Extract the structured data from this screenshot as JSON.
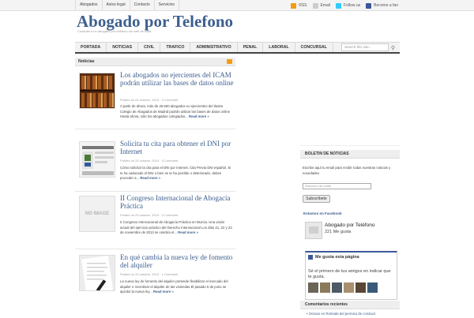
{
  "topnav": [
    "Abogados",
    "Aviso legal",
    "Contacto",
    "Servicios"
  ],
  "social": {
    "rss": "RSS",
    "email": "Email",
    "follow": "Follow us",
    "fan": "Become a fan"
  },
  "site": {
    "title": "Abogado por Telefono",
    "description": "Consulte a un abogado por teléfono sin salir de casa"
  },
  "nav": [
    "PORTADA",
    "NOTICIAS",
    "CIVIL",
    "TRAFICO",
    "ADMINISTRATIVO",
    "PENAL",
    "LABORAL",
    "CONCURSAL"
  ],
  "search": {
    "placeholder": "Search this site..."
  },
  "content": {
    "section": "Noticias",
    "posts": [
      {
        "title": "Los abogados no ejercientes del ICAM podrán utilizar las bases de datos online",
        "meta": "Posted on 24 octubre, 2013 · 0 Comment",
        "excerpt": "A partir de ahora, más de 26.500 abogados no ejercientes del Ilustre Colegio de Abogados de Madrid podrán utilizar las bases de datos online Hasta ahora, sólo los abogados colegiados...",
        "more": "Read more »"
      },
      {
        "title": "Solicita tu cita para obtener el DNI por Internet",
        "meta": "Posted on 24 octubre, 2013 · 0 Comment",
        "excerpt": "Cómo solicitar la cita para el DNI por Internet. Cita Previa DNI español. Si te ha caducado el DNI o bien se te ha perdido o deteriorado, debes proceder a...",
        "more": "Read more »"
      },
      {
        "title": "II Congreso Internacional de Abogacía Práctica",
        "meta": "Posted on 23 octubre, 2013 · 0 Comment",
        "excerpt": "II Congreso Internacional de Abogacía Práctica en Murcia. Una visión actual del ejercicio práctico del Derecho Internacional Los días 21, 22 y 23 de noviembre de 2013 se celebra el...",
        "more": "Read more »",
        "thumb": "NO IMAGE"
      },
      {
        "title": "En qué cambia la nueva ley de fomento del alquiler",
        "meta": "Posted on 23 octubre, 2013 · 1 Comment",
        "excerpt": "La nueva ley de fomento del alquiler pretende flexibilizar el mercado del alquiler e incentivar el alquiler de las viviendas El pasado 6 de junio se aprobó la nueva ley...",
        "more": "Read more »"
      }
    ]
  },
  "sidebar": {
    "newsletter_title": "BOLETIN DE NOTICIAS",
    "newsletter_text": "Escribe aquí tu email para recibir todas nuestras noticias y novedades",
    "email_placeholder": "Dirección de email",
    "subscribe": "Subscribete",
    "fb_heading": "Estamos en Facebook",
    "fb_page": "Abogado por Teléfono",
    "fb_likes": "221 Me gusta",
    "fb_widget_title": "Me gusta esta página",
    "fb_widget_text": "Sé el primero de tus amigos en indicar que te gusta.",
    "comments_title": "Comentarios recientes",
    "comment_item": "• Octavio en Retirada del permiso de conducir"
  },
  "colors": {
    "accent": "#3d5f8f",
    "facebook": "#3b5998",
    "rss": "#f39c12"
  }
}
